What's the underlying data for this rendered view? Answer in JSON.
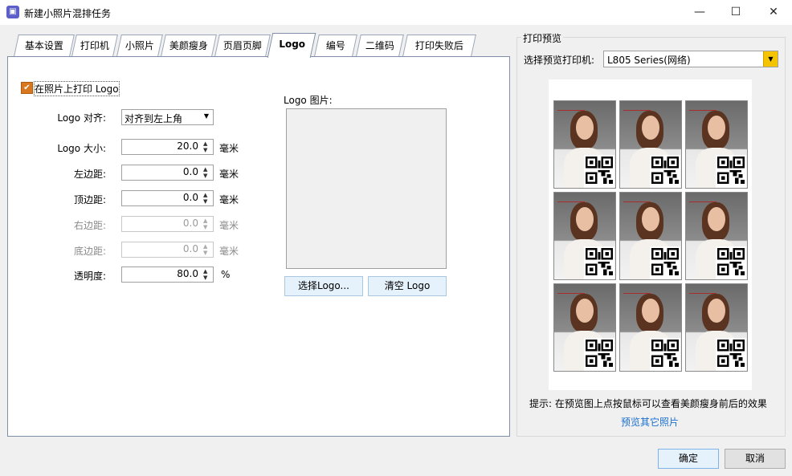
{
  "window": {
    "title": "新建小照片混排任务",
    "minimize_glyph": "—",
    "maximize_glyph": "☐",
    "close_glyph": "✕"
  },
  "tabs": [
    {
      "label": "基本设置"
    },
    {
      "label": "打印机"
    },
    {
      "label": "小照片"
    },
    {
      "label": "美颜瘦身"
    },
    {
      "label": "页眉页脚"
    },
    {
      "label": "Logo"
    },
    {
      "label": "编号"
    },
    {
      "label": "二维码"
    },
    {
      "label": "打印失败后"
    }
  ],
  "active_tab": "Logo",
  "logo": {
    "print_checkbox_label": "在照片上打印 Logo",
    "print_checked": true,
    "align_label": "Logo 对齐:",
    "align_value": "对齐到左上角",
    "size_label": "Logo 大小:",
    "size_value": "20.0",
    "left_label": "左边距:",
    "left_value": "0.0",
    "top_label": "顶边距:",
    "top_value": "0.0",
    "right_label": "右边距:",
    "right_value": "0.0",
    "bottom_label": "底边距:",
    "bottom_value": "0.0",
    "opacity_label": "透明度:",
    "opacity_value": "80.0",
    "unit_mm": "毫米",
    "unit_percent": "%",
    "image_label": "Logo 图片:",
    "choose_button": "选择Logo...",
    "clear_button": "清空 Logo"
  },
  "preview": {
    "group_title": "打印预览",
    "printer_label": "选择预览打印机:",
    "printer_value": "L805 Series(网络)",
    "hint": "提示: 在预览图上点按鼠标可以查看美颜瘦身前后的效果",
    "other_link": "预览其它照片",
    "photo_count": 9
  },
  "footer": {
    "ok_button": "确定",
    "cancel_button": "取消"
  },
  "colors": {
    "accent_link": "#1a6fd0",
    "checkbox": "#d8781e",
    "dropdown_button": "#f5c400",
    "logo_text_red": "#d00000"
  }
}
